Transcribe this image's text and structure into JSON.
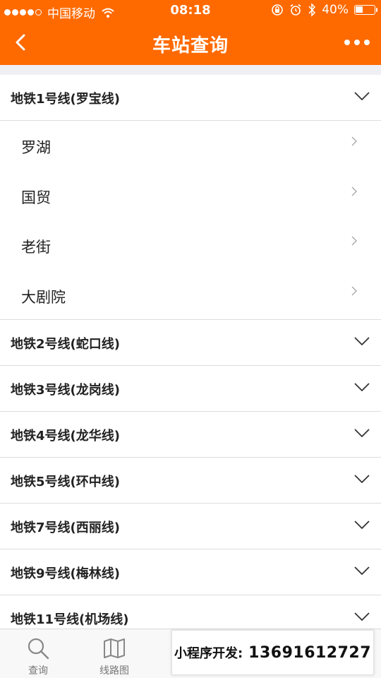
{
  "status_bar": {
    "signal_dots_filled": 4,
    "signal_dots_total": 5,
    "carrier": "中国移动",
    "time": "08:18",
    "battery_text": "40%",
    "battery_level": 0.4
  },
  "nav": {
    "title": "车站查询",
    "back_icon": "back-arrow-icon",
    "more_icon": "more-dots-icon"
  },
  "lines": [
    {
      "name": "地铁1号线(罗宝线)",
      "expanded": true,
      "stations": [
        "罗湖",
        "国贸",
        "老街",
        "大剧院"
      ]
    },
    {
      "name": "地铁2号线(蛇口线)",
      "expanded": false
    },
    {
      "name": "地铁3号线(龙岗线)",
      "expanded": false
    },
    {
      "name": "地铁4号线(龙华线)",
      "expanded": false
    },
    {
      "name": "地铁5号线(环中线)",
      "expanded": false
    },
    {
      "name": "地铁7号线(西丽线)",
      "expanded": false
    },
    {
      "name": "地铁9号线(梅林线)",
      "expanded": false
    },
    {
      "name": "地铁11号线(机场线)",
      "expanded": false
    }
  ],
  "tabbar": {
    "tabs": [
      {
        "label": "查询",
        "icon": "search-icon"
      },
      {
        "label": "线路图",
        "icon": "map-icon"
      }
    ]
  },
  "overlay": {
    "label": "小程序开发:",
    "phone": "13691612727"
  },
  "colors": {
    "brand": "#ff6a00",
    "text": "#222222",
    "divider": "#dcdcdc"
  }
}
